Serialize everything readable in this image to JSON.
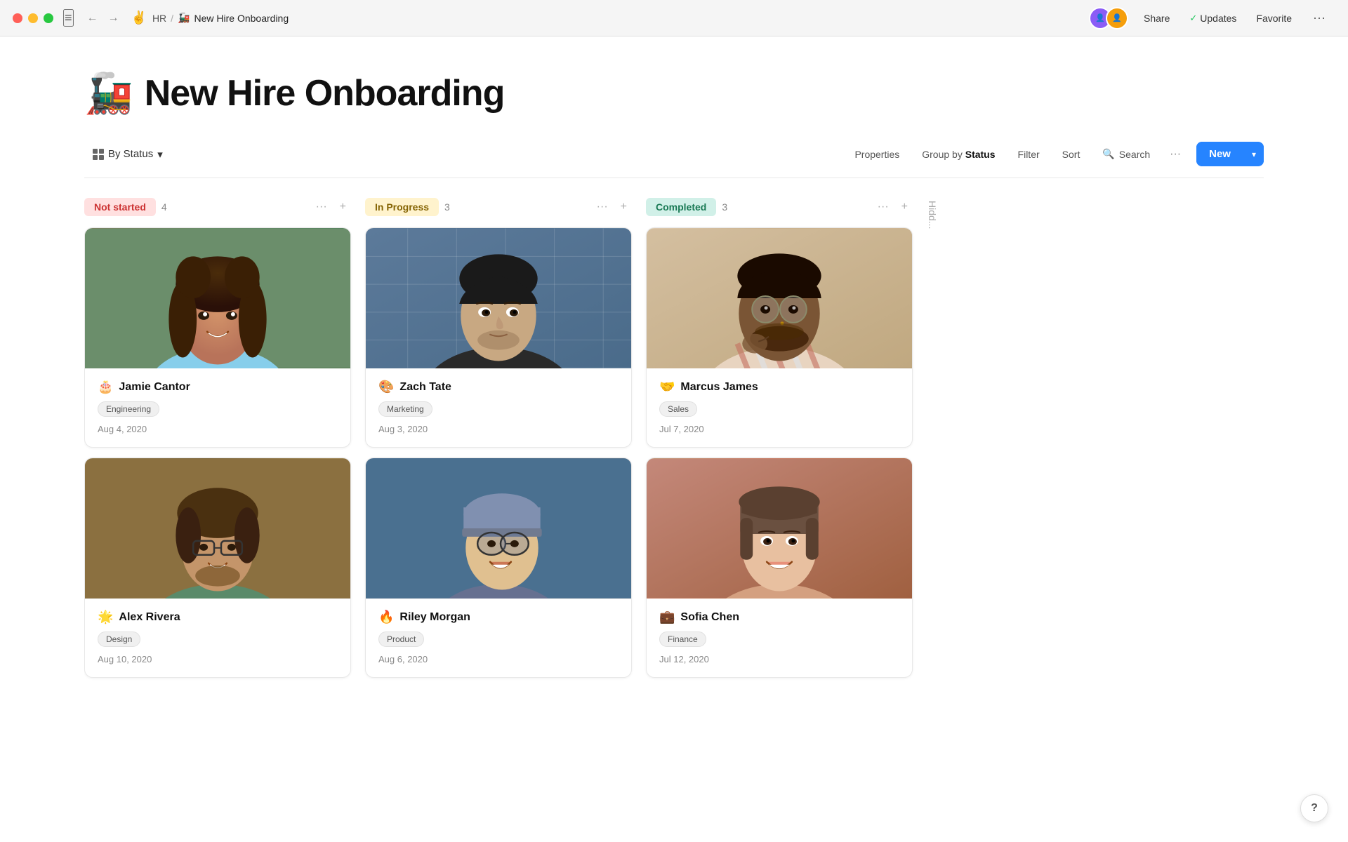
{
  "titlebar": {
    "breadcrumb_parent": "HR",
    "breadcrumb_separator": "/",
    "page_name": "New Hire Onboarding",
    "page_emoji": "🚂",
    "share_label": "Share",
    "updates_label": "Updates",
    "favorite_label": "Favorite"
  },
  "page": {
    "title_emoji": "🚂",
    "title": "New Hire Onboarding"
  },
  "toolbar": {
    "view_label": "By Status",
    "properties_label": "Properties",
    "group_by_label": "Group by",
    "group_by_field": "Status",
    "filter_label": "Filter",
    "sort_label": "Sort",
    "search_label": "Search",
    "more_label": "···",
    "new_label": "New"
  },
  "columns": [
    {
      "id": "not-started",
      "status": "Not started",
      "status_class": "status-not-started",
      "count": 4,
      "cards": [
        {
          "name": "Jamie Cantor",
          "emoji": "🎂",
          "tag": "Engineering",
          "date": "Aug 4, 2020",
          "photo_class": "photo-1"
        },
        {
          "name": "Alex Rivera",
          "emoji": "🌟",
          "tag": "Design",
          "date": "Aug 10, 2020",
          "photo_class": "photo-4"
        }
      ]
    },
    {
      "id": "in-progress",
      "status": "In Progress",
      "status_class": "status-in-progress",
      "count": 3,
      "cards": [
        {
          "name": "Zach Tate",
          "emoji": "🎨",
          "tag": "Marketing",
          "date": "Aug 3, 2020",
          "photo_class": "photo-2"
        },
        {
          "name": "Riley Morgan",
          "emoji": "🔥",
          "tag": "Product",
          "date": "Aug 6, 2020",
          "photo_class": "photo-5"
        }
      ]
    },
    {
      "id": "completed",
      "status": "Completed",
      "status_class": "status-completed",
      "count": 3,
      "cards": [
        {
          "name": "Marcus James",
          "emoji": "🤝",
          "tag": "Sales",
          "date": "Jul 7, 2020",
          "photo_class": "photo-3"
        },
        {
          "name": "Sofia Chen",
          "emoji": "💼",
          "tag": "Finance",
          "date": "Jul 12, 2020",
          "photo_class": "photo-6"
        }
      ]
    }
  ],
  "hidden_column_label": "Hidd...",
  "help_label": "?"
}
